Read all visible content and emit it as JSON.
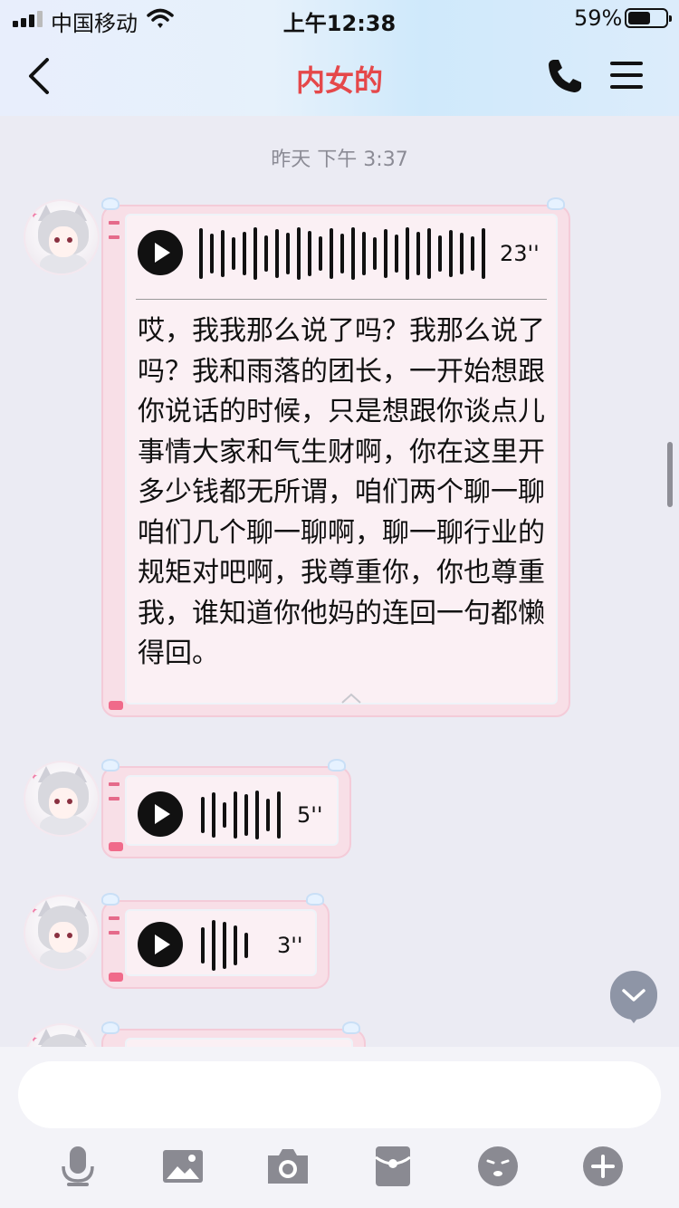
{
  "status_bar": {
    "carrier": "中国移动",
    "time": "上午12:38",
    "battery_percent": "59%",
    "battery_level": 0.59,
    "signal_bars": 3
  },
  "nav": {
    "title": "内女的",
    "back_icon": "chevron-left-icon",
    "call_icon": "phone-icon",
    "menu_icon": "hamburger-menu-icon"
  },
  "chat": {
    "timestamp": "昨天 下午 3:37",
    "messages": [
      {
        "type": "voice",
        "duration": "23''",
        "transcript": "哎，我我那么说了吗？我那么说了吗？我和雨落的团长，一开始想跟你说话的时候，只是想跟你谈点儿事情大家和气生财啊，你在这里开多少钱都无所谓，咱们两个聊一聊咱们几个聊一聊啊，聊一聊行业的规矩对吧啊，我尊重你，你也尊重我，谁知道你他妈的连回一句都懒得回。"
      },
      {
        "type": "voice",
        "duration": "5''"
      },
      {
        "type": "voice",
        "duration": "3''"
      }
    ]
  },
  "input": {
    "placeholder": ""
  },
  "toolbar": [
    "microphone-icon",
    "image-icon",
    "camera-icon",
    "red-envelope-icon",
    "emoji-icon",
    "plus-icon"
  ],
  "colors": {
    "title": "#e5484a",
    "bubble_frame": "#f8dfe7",
    "tool_icon": "#8a8a92"
  }
}
